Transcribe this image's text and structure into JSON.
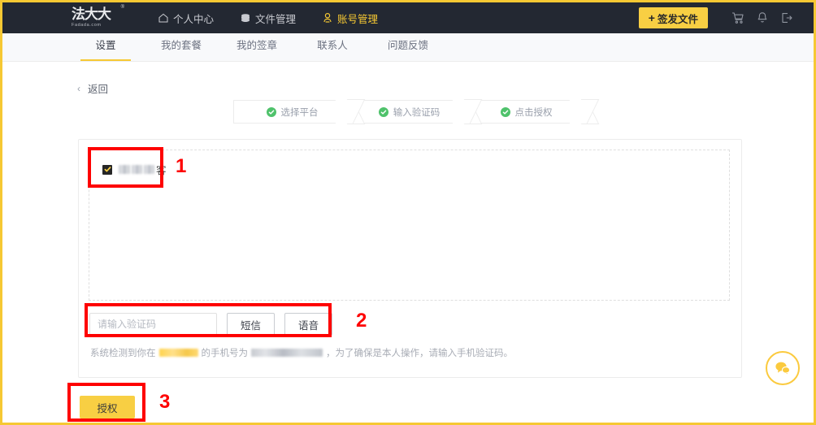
{
  "header": {
    "logo": {
      "main": "法大大",
      "registered": "®",
      "sub": "Fadada.com"
    },
    "nav_items": [
      {
        "label": "个人中心",
        "icon": "home-icon",
        "active": false
      },
      {
        "label": "文件管理",
        "icon": "folder-icon",
        "active": false
      },
      {
        "label": "账号管理",
        "icon": "user-icon",
        "active": true
      }
    ],
    "issue_button": {
      "label": "签发文件",
      "plus": "+"
    },
    "right_icons": [
      {
        "name": "cart-icon"
      },
      {
        "name": "bell-icon"
      },
      {
        "name": "logout-icon"
      }
    ]
  },
  "tabs": [
    {
      "label": "设置",
      "active": true
    },
    {
      "label": "我的套餐",
      "active": false
    },
    {
      "label": "我的签章",
      "active": false
    },
    {
      "label": "联系人",
      "active": false
    },
    {
      "label": "问题反馈",
      "active": false
    }
  ],
  "back": {
    "label": "返回",
    "chevron": "‹"
  },
  "steps": [
    {
      "label": "选择平台",
      "done": true
    },
    {
      "label": "输入验证码",
      "done": true
    },
    {
      "label": "点击授权",
      "done": true
    }
  ],
  "platform": {
    "checked": true,
    "label_masked": "客",
    "label_note": "名称已打码"
  },
  "verify": {
    "placeholder": "请输入验证码",
    "value": "",
    "sms_button": "短信",
    "voice_button": "语音"
  },
  "hint": {
    "part1": "系统检测到你在",
    "part2": "的手机号为",
    "part3": "，为了确保是本人操作，请输入手机验证码。"
  },
  "authorize_button": {
    "label": "授权"
  },
  "annotations": [
    {
      "number": "1",
      "target": "platform-checkbox"
    },
    {
      "number": "2",
      "target": "verification-row"
    },
    {
      "number": "3",
      "target": "authorize-button"
    }
  ],
  "chat": {
    "name": "chat-support-button"
  },
  "colors": {
    "brand_yellow": "#f8cf43",
    "nav_dark": "#232832",
    "step_green": "#4fc26b",
    "annotation_red": "#fe0000"
  }
}
